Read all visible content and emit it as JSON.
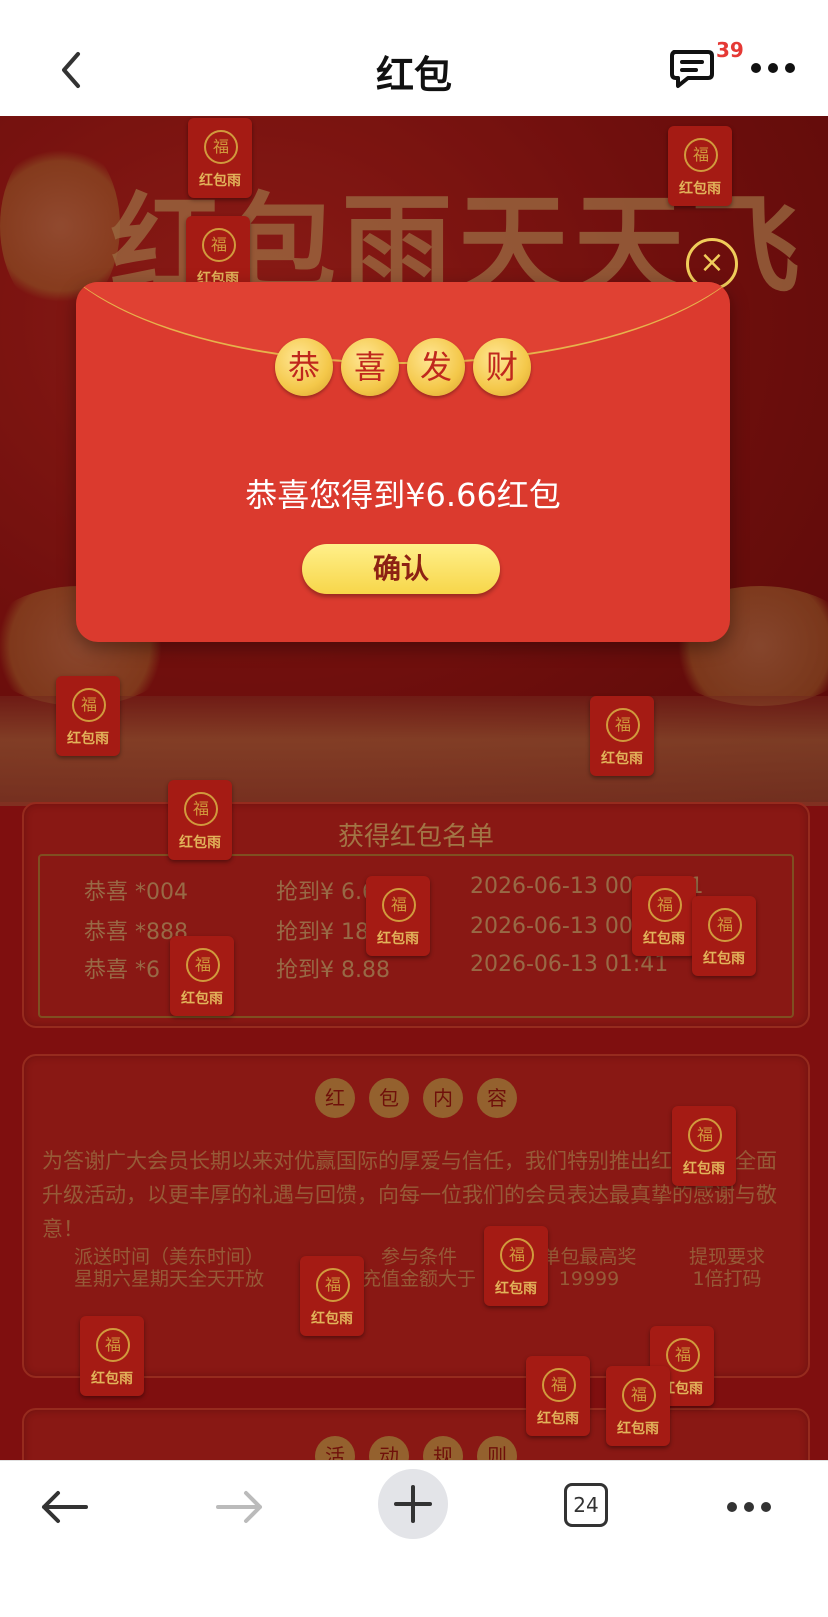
{
  "nav": {
    "title": "红包",
    "message_badge": "39"
  },
  "hero": {
    "title": "红包雨天天飞"
  },
  "envelope_seal": "福",
  "envelope_label": "红包雨",
  "winners": {
    "title": "获得红包名单",
    "rows": [
      {
        "name": "恭喜 *004",
        "amount": "抢到¥ 6.66",
        "time": "2026-06-13 00:04:51"
      },
      {
        "name": "恭喜 *888",
        "amount": "抢到¥ 18.88",
        "time": "2026-06-13 00:34:12"
      },
      {
        "name": "恭喜 *6",
        "amount": "抢到¥ 8.88",
        "time": "2026-06-13 01:41"
      }
    ]
  },
  "rules": {
    "title_chars": [
      "红",
      "包",
      "内",
      "容"
    ],
    "description": "为答谢广大会员长期以来对优赢国际的厚爱与信任，我们特别推出红包福利全面升级活动，以更丰厚的礼遇与回馈，向每一位我们的会员表达最真挚的感谢与敬意！",
    "columns": [
      {
        "heading": "派送时间（美东时间）",
        "value": "星期六星期天全天开放"
      },
      {
        "heading": "参与条件",
        "value": "充值金额大于"
      },
      {
        "heading": "单包最高奖",
        "value": "19999"
      },
      {
        "heading": "提现要求",
        "value": "1倍打码"
      }
    ]
  },
  "next_section": {
    "title_chars": [
      "活",
      "动",
      "规",
      "则"
    ]
  },
  "modal": {
    "coins": [
      "恭",
      "喜",
      "发",
      "财"
    ],
    "message": "恭喜您得到¥6.66红包",
    "confirm_label": "确认",
    "close_icon": "×"
  },
  "bottom_bar": {
    "tabs_count": "24"
  },
  "colors": {
    "accent_red": "#db3a2e",
    "gold": "#f4c84a",
    "badge_red": "#e53935"
  }
}
